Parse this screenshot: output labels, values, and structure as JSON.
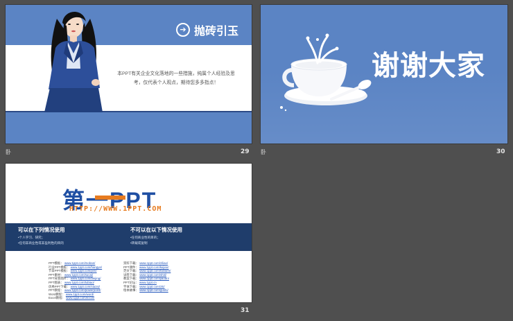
{
  "slides": [
    {
      "number": "29",
      "title": "抛砖引玉",
      "body": "本PPT有关企业文化落地的一些措施，纯属个人经验及思考，仅代表个人观点，期待您多多指点！",
      "mark": "卧"
    },
    {
      "number": "30",
      "title": "谢谢大家",
      "mark": "卧"
    },
    {
      "number": "31",
      "logo_text": "第一PPT",
      "url": "HTTP://WWW.1PPT.COM",
      "left_heading": "可以在下列情况使用",
      "left_lines": [
        "•个人学习、研究；",
        "•任何非商业性或非盈利性的目的"
      ],
      "right_heading": "不可以在以下情况使用",
      "right_lines": [
        "•任何商业性的目的；",
        "•转载或复制"
      ],
      "links_left": [
        {
          "label": "PPT模板：",
          "url": "www.1ppt.com/moban/"
        },
        {
          "label": "行业PPT模板：",
          "url": "www.1ppt.com/hangye/"
        },
        {
          "label": "节日PPT模板：",
          "url": "www.1ppt.com/jieri/"
        },
        {
          "label": "PPT素材：",
          "url": "www.1ppt.com/sucai/"
        },
        {
          "label": "PPT背景图片：",
          "url": "www.1ppt.com/beijing/"
        },
        {
          "label": "PPT图表：",
          "url": "www.1ppt.com/tubiao/"
        },
        {
          "label": "优秀PPT下载：",
          "url": "www.1ppt.com/xiazai/"
        },
        {
          "label": "PPT教程：",
          "url": "www.1ppt.com/powerpoint/"
        },
        {
          "label": "Word教程：",
          "url": "www.1ppt.com/word/"
        },
        {
          "label": "Excel教程：",
          "url": "www.1ppt.com/excel/"
        }
      ],
      "links_right": [
        {
          "label": "资料下载：",
          "url": "www.1ppt.com/ziliao/"
        },
        {
          "label": "PPT课件：",
          "url": "www.1ppt.com/kejian/"
        },
        {
          "label": "范文下载：",
          "url": "www.1ppt.com/fanwen/"
        },
        {
          "label": "试卷下载：",
          "url": "www.1ppt.com/shiti/"
        },
        {
          "label": "教案下载：",
          "url": "www.1ppt.com/jiaoan/"
        },
        {
          "label": "PPT论坛：",
          "url": "www.1ppt.cn"
        },
        {
          "label": "字体下载：",
          "url": "www.1ppt.com/ziti/"
        },
        {
          "label": "绘本故事：",
          "url": "www.1ppt.com/gushi/"
        }
      ]
    }
  ],
  "colors": {
    "background": "#4f4f4f",
    "slide_blue": "#5b84c4",
    "logo_blue": "#1f4fa3",
    "logo_orange": "#e77b1f",
    "band_navy": "#1f3d6b"
  }
}
